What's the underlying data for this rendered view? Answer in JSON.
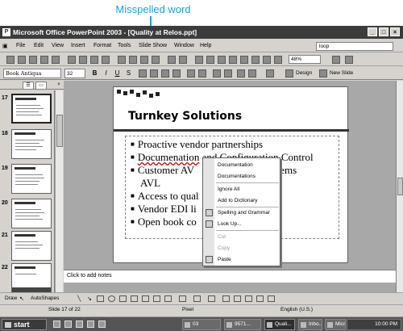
{
  "annotation": {
    "callout": "Misspelled word"
  },
  "window": {
    "title": "Microsoft Office PowerPoint 2003 - [Quality at Relos.ppt]",
    "controls": [
      "_",
      "□",
      "×"
    ]
  },
  "menu": {
    "items": [
      "File",
      "Edit",
      "View",
      "Insert",
      "Format",
      "Tools",
      "Slide Show",
      "Window",
      "Help"
    ],
    "help_box": "loop"
  },
  "standard_toolbar": {
    "zoom": "48%"
  },
  "format_toolbar": {
    "font": "Book Antiqua",
    "size": "32",
    "bold": "B",
    "italic": "I",
    "underline": "U",
    "shadow": "S",
    "design": "Design",
    "new_slide": "New Slide"
  },
  "thumbnails": [
    {
      "num": "17",
      "selected": true
    },
    {
      "num": "18",
      "selected": false
    },
    {
      "num": "19",
      "selected": false
    },
    {
      "num": "20",
      "selected": false
    },
    {
      "num": "21",
      "selected": false
    },
    {
      "num": "22",
      "selected": false
    }
  ],
  "slide": {
    "title": "Turnkey Solutions",
    "bullets": [
      "Proactive vendor partnerships",
      "Documenation and Configuration Control",
      "Customer AVL and Enterprise systems",
      "AVL",
      "Access to quality data",
      "Vendor EDI link",
      "Open book costing"
    ],
    "b1": "Proactive vendor partnerships",
    "b2_misspelled": "Documenation",
    "b2_rest": " and Configuration Control",
    "b3": "Customer AV",
    "b3_tail": "systems",
    "b3_cont": "AVL",
    "b4": "Access to qual",
    "b5": "Vendor EDI li",
    "b6": "Open book co"
  },
  "context_menu": {
    "suggestions": [
      "Documentation",
      "Documentations"
    ],
    "ignore_all": "Ignore All",
    "add_to_dictionary": "Add to Dictionary",
    "spelling": "Spelling and Grammar",
    "look_up": "Look Up...",
    "cut": "Cut",
    "copy": "Copy",
    "paste": "Paste"
  },
  "notes": {
    "placeholder": "Click to add notes"
  },
  "drawing_toolbar": {
    "draw": "Draw",
    "autoshapes": "AutoShapes"
  },
  "status": {
    "slide": "Slide 17 of 22",
    "design": "Pixel",
    "language": "English (U.S.)"
  },
  "taskbar": {
    "start": "start",
    "tasks": [
      "03",
      "9571...",
      "Quali...",
      "Inbo...",
      "Micr..."
    ],
    "clock": "10:00 PM"
  }
}
